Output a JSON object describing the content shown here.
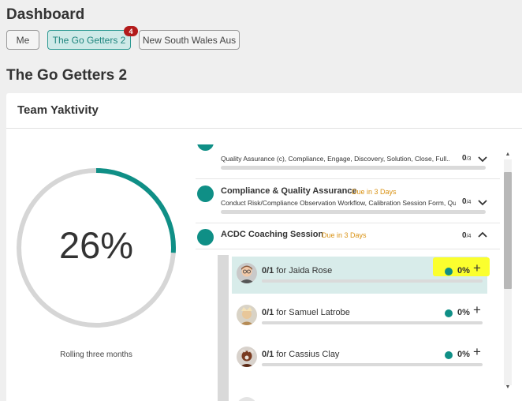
{
  "header": {
    "title": "Dashboard"
  },
  "tabs": [
    {
      "label": "Me",
      "active": false
    },
    {
      "label": "The Go Getters 2",
      "active": true,
      "badge": "4"
    },
    {
      "label": "New South Wales Aus",
      "active": false
    }
  ],
  "team": {
    "title": "The Go Getters 2"
  },
  "card": {
    "title": "Team Yaktivity",
    "progress": {
      "label": "26%",
      "value": 0.26,
      "caption": "Rolling three months"
    }
  },
  "activities": [
    {
      "title": "",
      "due": "",
      "description": "Quality Assurance (c), Compliance, Engage, Discovery, Solution, Close, Full...",
      "count": "0",
      "total": "/3",
      "expanded": false
    },
    {
      "title": "Compliance & Quality Assurance",
      "due": "Due in 3 Days",
      "description": "Conduct Risk/Compliance Observation Workflow, Calibration Session Form, Quali...",
      "count": "0",
      "total": "/4",
      "expanded": false
    },
    {
      "title": "ACDC Coaching Session",
      "due": "Due in 3 Days",
      "description": "",
      "count": "0",
      "total": "/4",
      "expanded": true,
      "members": [
        {
          "progress": "0/1",
          "for_text": "for Jaida Rose",
          "percent": "0%",
          "highlight": true
        },
        {
          "progress": "0/1",
          "for_text": "for Samuel Latrobe",
          "percent": "0%",
          "highlight": false
        },
        {
          "progress": "0/1",
          "for_text": "for Cassius Clay",
          "percent": "0%",
          "highlight": false
        }
      ]
    }
  ],
  "colors": {
    "accent": "#0f8f86",
    "due": "#d99214",
    "badge": "#b31b1b",
    "highlight": "#fbff2e"
  },
  "icons": {
    "expand": "chevron-down-icon",
    "collapse": "chevron-up-icon",
    "add": "plus-icon"
  }
}
